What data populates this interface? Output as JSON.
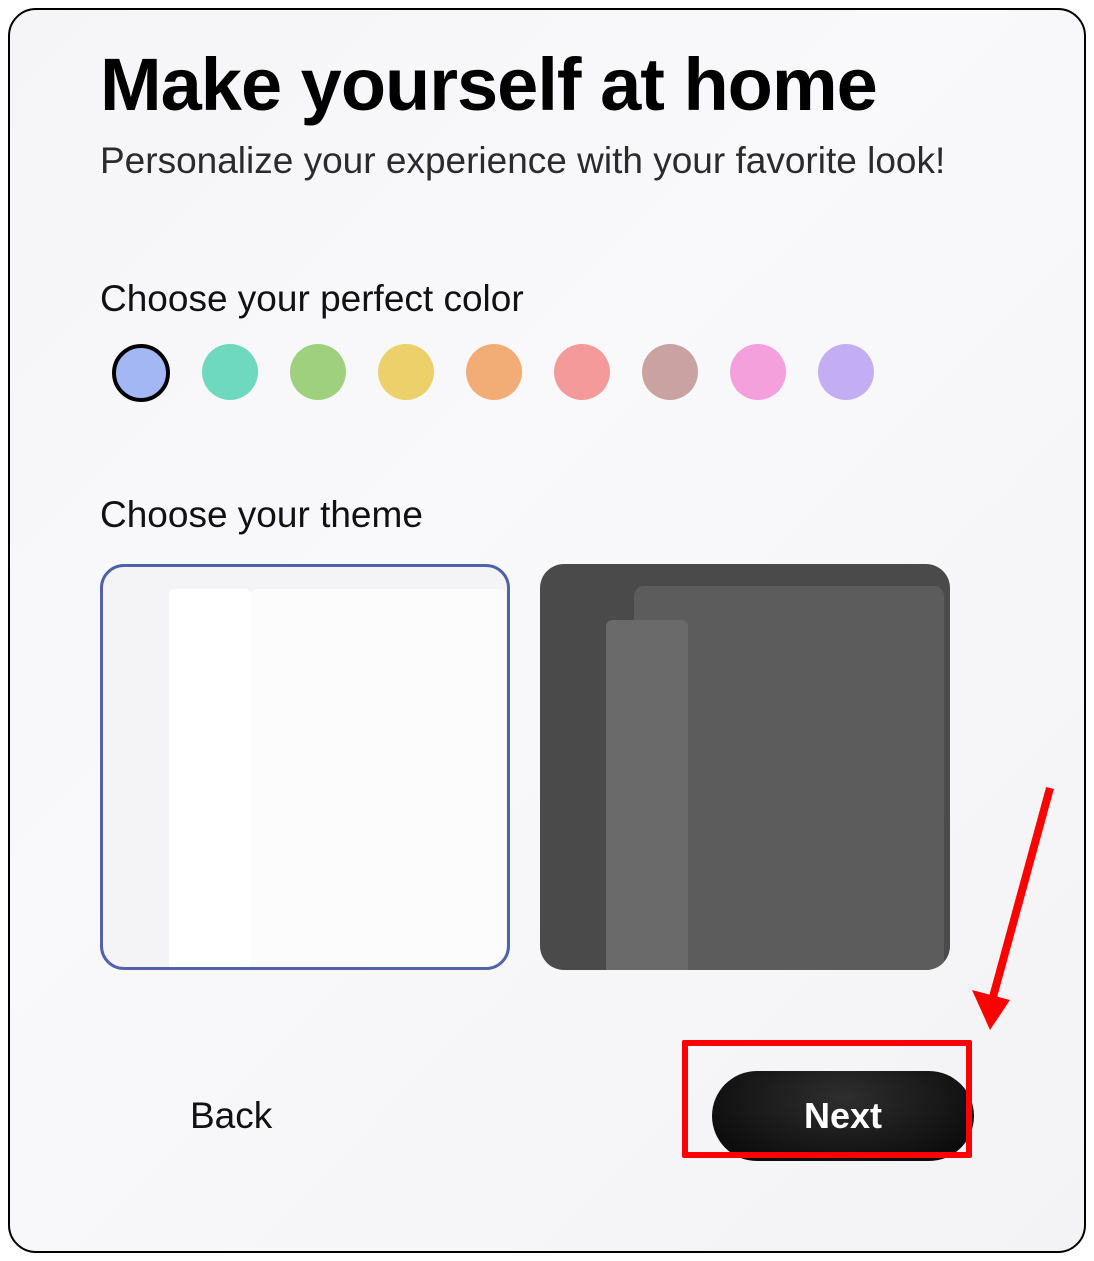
{
  "title": "Make yourself at home",
  "subtitle": "Personalize your experience with your favorite look!",
  "color_section": {
    "label": "Choose your perfect color",
    "selected_index": 0,
    "swatches": [
      {
        "name": "blue",
        "hex": "#a2b7f4"
      },
      {
        "name": "teal",
        "hex": "#6ed9bd"
      },
      {
        "name": "green",
        "hex": "#9ed07e"
      },
      {
        "name": "yellow",
        "hex": "#ecd06a"
      },
      {
        "name": "orange",
        "hex": "#f2ad77"
      },
      {
        "name": "coral",
        "hex": "#f49a9a"
      },
      {
        "name": "mauve",
        "hex": "#cba2a2"
      },
      {
        "name": "pink",
        "hex": "#f4a0dd"
      },
      {
        "name": "purple",
        "hex": "#c3aef4"
      }
    ]
  },
  "theme_section": {
    "label": "Choose your theme",
    "selected": "light",
    "options": [
      "light",
      "dark"
    ]
  },
  "footer": {
    "back_label": "Back",
    "next_label": "Next"
  },
  "annotation": {
    "arrow_target": "next-button"
  }
}
